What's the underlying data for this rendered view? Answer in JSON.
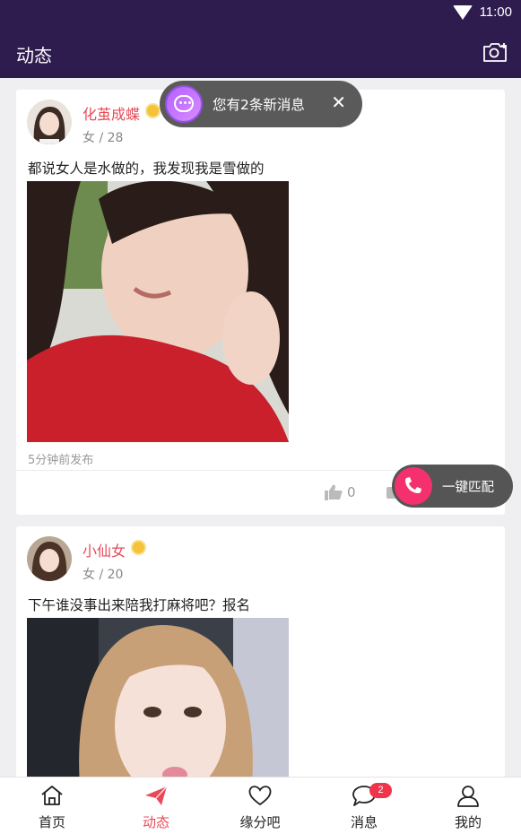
{
  "status_bar": {
    "time": "11:00"
  },
  "app_bar": {
    "title": "动态",
    "camera_icon": "camera-add-icon"
  },
  "toast": {
    "text": "您有2条新消息",
    "icon": "chat-bubble-icon",
    "close_icon": "close-icon"
  },
  "match_button": {
    "label": "一键匹配",
    "icon": "phone-icon"
  },
  "posts": [
    {
      "username": "化茧成蝶",
      "meta": "女 / 28",
      "text": "都说女人是水做的，我发现我是雪做的",
      "time": "5分钟前发布",
      "likes": "0"
    },
    {
      "username": "小仙女",
      "meta": "女 / 20",
      "text": "下午谁没事出来陪我打麻将吧？报名"
    }
  ],
  "nav": [
    {
      "label": "首页",
      "icon": "home-icon"
    },
    {
      "label": "动态",
      "icon": "paper-plane-icon",
      "active": true
    },
    {
      "label": "缘分吧",
      "icon": "heart-icon"
    },
    {
      "label": "消息",
      "icon": "chat-icon",
      "badge": "2"
    },
    {
      "label": "我的",
      "icon": "user-icon"
    }
  ],
  "colors": {
    "app_bar": "#2e1c4f",
    "accent": "#e84a58",
    "match": "#f5306f",
    "badge": "#f0344a"
  }
}
